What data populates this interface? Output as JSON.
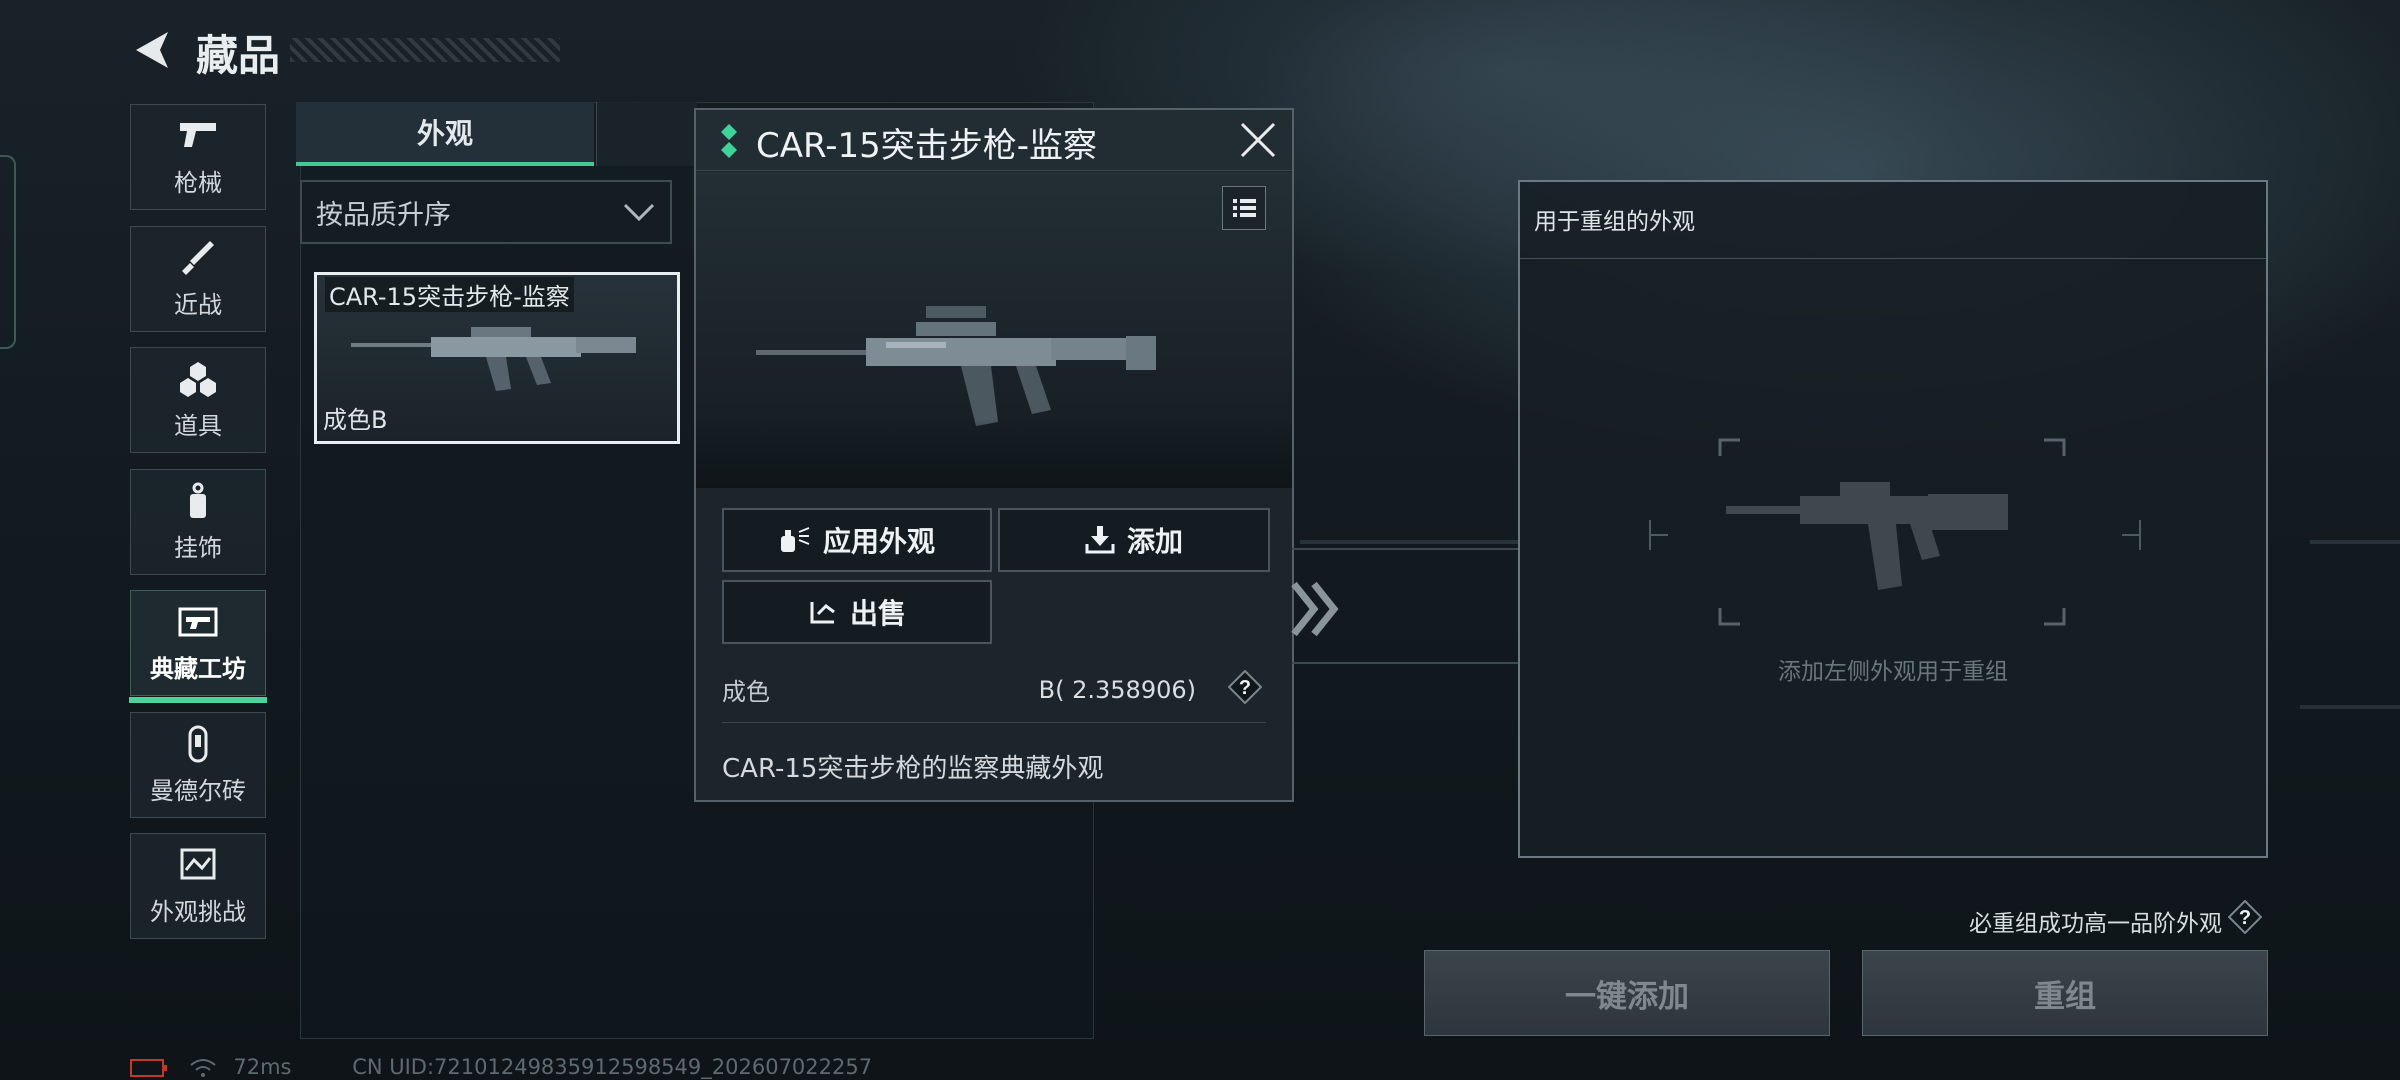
{
  "header": {
    "title": "藏品"
  },
  "nav": [
    {
      "label": "枪械",
      "icon": "pistol-icon"
    },
    {
      "label": "近战",
      "icon": "knife-icon"
    },
    {
      "label": "道具",
      "icon": "grenades-icon"
    },
    {
      "label": "挂饰",
      "icon": "charm-icon"
    },
    {
      "label": "典藏工坊",
      "icon": "workshop-icon",
      "active": true
    },
    {
      "label": "曼德尔砖",
      "icon": "mandel-brick-icon"
    },
    {
      "label": "外观挑战",
      "icon": "challenge-icon"
    }
  ],
  "list": {
    "tab_label": "外观",
    "sort_label": "按品质升序",
    "item": {
      "name": "CAR-15突击步枪-监察",
      "quality": "成色B"
    }
  },
  "popup": {
    "title": "CAR-15突击步枪-监察",
    "buttons": {
      "apply": "应用外观",
      "add": "添加",
      "sell": "出售"
    },
    "attr_label": "成色",
    "attr_value": "B( 2.358906)",
    "help": "?",
    "description": "CAR-15突击步枪的监察典藏外观"
  },
  "recombine": {
    "title": "用于重组的外观",
    "hint": "添加左侧外观用于重组",
    "note": "必重组成功高一品阶外观",
    "help": "?",
    "add_all": "一键添加",
    "recombine": "重组"
  },
  "status": {
    "ping": "72ms",
    "uid": "CN UID:7210124983591259854​9_202607022257"
  },
  "colors": {
    "accent": "#46c895",
    "rarity": "#3fd29a"
  }
}
